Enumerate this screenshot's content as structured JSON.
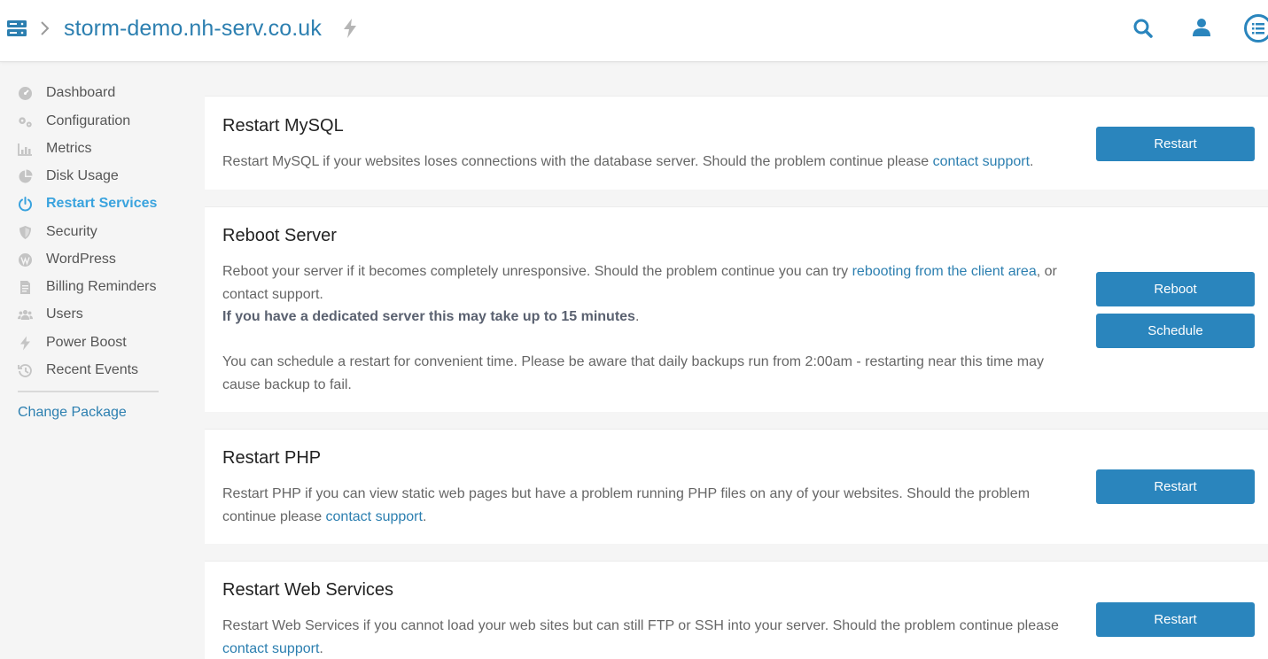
{
  "header": {
    "hostname": "storm-demo.nh-serv.co.uk"
  },
  "sidebar": {
    "items": [
      {
        "label": "Dashboard",
        "icon": "dashboard-icon",
        "active": false
      },
      {
        "label": "Configuration",
        "icon": "cogs-icon",
        "active": false
      },
      {
        "label": "Metrics",
        "icon": "chart-icon",
        "active": false
      },
      {
        "label": "Disk Usage",
        "icon": "pie-icon",
        "active": false
      },
      {
        "label": "Restart Services",
        "icon": "power-icon",
        "active": true
      },
      {
        "label": "Security",
        "icon": "shield-icon",
        "active": false
      },
      {
        "label": "WordPress",
        "icon": "wordpress-icon",
        "active": false
      },
      {
        "label": "Billing Reminders",
        "icon": "document-icon",
        "active": false
      },
      {
        "label": "Users",
        "icon": "users-icon",
        "active": false
      },
      {
        "label": "Power Boost",
        "icon": "bolt-icon",
        "active": false
      },
      {
        "label": "Recent Events",
        "icon": "history-icon",
        "active": false
      }
    ],
    "change_package": "Change Package"
  },
  "cards": {
    "mysql": {
      "title": "Restart MySQL",
      "desc_1": "Restart MySQL if your websites loses connections with the database server. Should the problem continue please ",
      "link": "contact support",
      "desc_2": ".",
      "button": "Restart"
    },
    "reboot": {
      "title": "Reboot Server",
      "desc_1": "Reboot your server if it becomes completely unresponsive. Should the problem continue you can try ",
      "link": "rebooting from the client area",
      "desc_2": ", or contact support.",
      "bold": "If you have a dedicated server this may take up to 15 minutes",
      "bold_end": ".",
      "desc_3": "You can schedule a restart for convenient time. Please be aware that daily backups run from 2:00am - restarting near this time may cause backup to fail.",
      "button": "Reboot",
      "button_2": "Schedule"
    },
    "php": {
      "title": "Restart PHP",
      "desc_1": "Restart PHP if you can view static web pages but have a problem running PHP files on any of your websites. Should the problem continue please ",
      "link": "contact support",
      "desc_2": ".",
      "button": "Restart"
    },
    "web": {
      "title": "Restart Web Services",
      "desc_1": "Restart Web Services if you cannot load your web sites but can still FTP or SSH into your server. Should the problem continue please ",
      "link": "contact support",
      "desc_2": ".",
      "button": "Restart"
    }
  },
  "colors": {
    "accent": "#2a85bd",
    "link": "#2c7fb0",
    "active_nav": "#3aa3de"
  }
}
